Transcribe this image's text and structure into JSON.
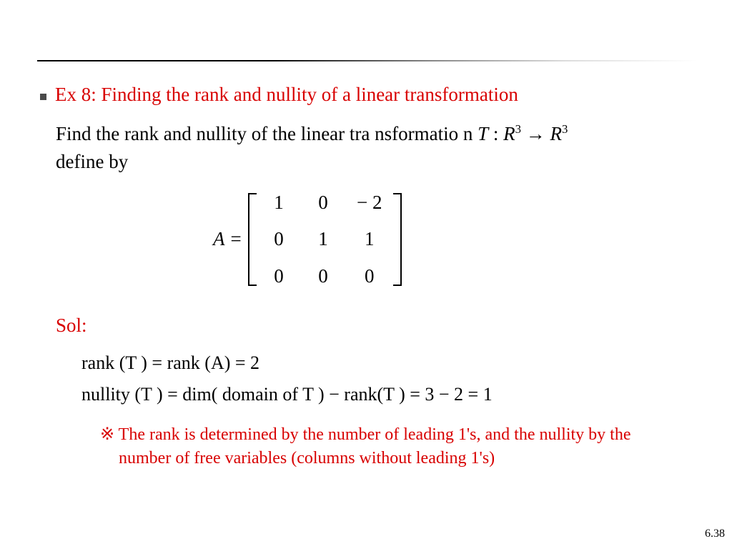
{
  "title": "Ex 8: Finding the rank and nullity of a linear transformation",
  "problem": {
    "line1_prefix": "Find  the rank and nullity  of  the linear tra nsformatio n ",
    "T": "T",
    "colon": " : ",
    "R": "R",
    "exp": "3",
    "arrow": " → ",
    "line2": "define  by"
  },
  "matrix": {
    "label": "A =",
    "rows": [
      [
        "1",
        "0",
        "− 2"
      ],
      [
        "0",
        "1",
        "1"
      ],
      [
        "0",
        "0",
        "0"
      ]
    ]
  },
  "sol_label": "Sol:",
  "equations": {
    "rank": "rank (T ) = rank (A) = 2",
    "nullity": "nullity  (T ) = dim( domain  of T ) − rank(T ) = 3 − 2 = 1"
  },
  "note": "※ The rank is determined by the number of leading 1's, and the nullity by the number of free variables (columns without leading 1's)",
  "page_number": "6.38"
}
